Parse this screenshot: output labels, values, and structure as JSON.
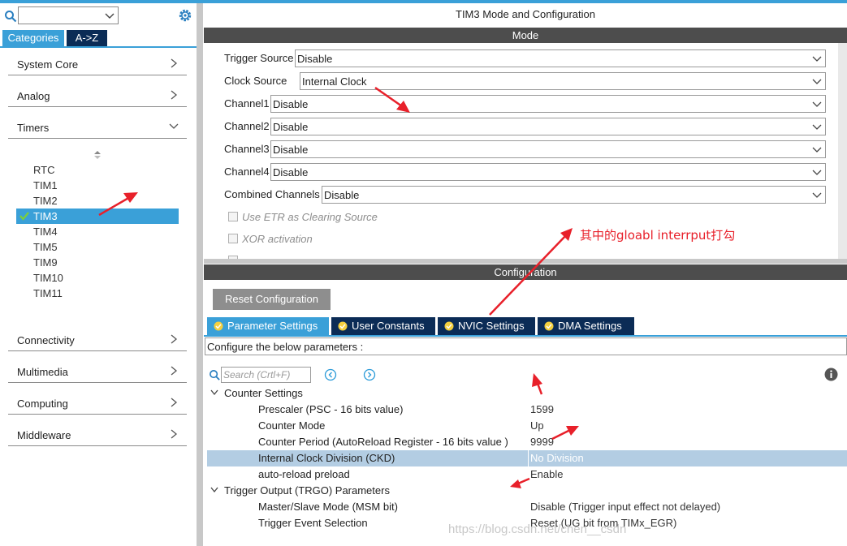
{
  "colors": {
    "accent": "#3aa0d8",
    "navy": "#0b2c56",
    "band": "#4d4d4d",
    "selected_row": "#b3cde3",
    "annotation": "#e8202a"
  },
  "left": {
    "tabs": {
      "categories": "Categories",
      "az": "A->Z"
    },
    "categories": [
      "System Core",
      "Analog",
      "Timers"
    ],
    "timers": [
      "RTC",
      "TIM1",
      "TIM2",
      "TIM3",
      "TIM4",
      "TIM5",
      "TIM9",
      "TIM10",
      "TIM11"
    ],
    "selected_timer": "TIM3",
    "bottom_categories": [
      "Connectivity",
      "Multimedia",
      "Computing",
      "Middleware"
    ]
  },
  "right": {
    "title": "TIM3 Mode and Configuration",
    "mode_band": "Mode",
    "mode_rows": [
      {
        "label": "Trigger Source",
        "value": "Disable"
      },
      {
        "label": "Clock Source",
        "value": "Internal Clock"
      },
      {
        "label": "Channel1",
        "value": "Disable"
      },
      {
        "label": "Channel2",
        "value": "Disable"
      },
      {
        "label": "Channel3",
        "value": "Disable"
      },
      {
        "label": "Channel4",
        "value": "Disable"
      },
      {
        "label": "Combined Channels",
        "value": "Disable"
      }
    ],
    "checkboxes": [
      "Use ETR as Clearing Source",
      "XOR activation"
    ],
    "config_band": "Configuration",
    "reset_button": "Reset Configuration",
    "config_tabs": [
      "Parameter Settings",
      "User Constants",
      "NVIC Settings",
      "DMA Settings"
    ],
    "configure_text": "Configure the below parameters :",
    "search_placeholder": "Search (Crtl+F)",
    "groups": {
      "counter": "Counter Settings",
      "trgo": "Trigger Output (TRGO) Parameters"
    },
    "params": [
      {
        "name": "Prescaler (PSC - 16 bits value)",
        "value": "1599"
      },
      {
        "name": "Counter Mode",
        "value": "Up"
      },
      {
        "name": "Counter Period (AutoReload Register - 16 bits value )",
        "value": "9999"
      },
      {
        "name": "Internal Clock Division (CKD)",
        "value": "No Division"
      },
      {
        "name": "auto-reload preload",
        "value": "Enable"
      },
      {
        "name": "Master/Slave Mode (MSM bit)",
        "value": "Disable (Trigger input effect not delayed)"
      },
      {
        "name": "Trigger Event Selection",
        "value": "Reset (UG bit from TIMx_EGR)"
      }
    ]
  },
  "annotation_text": "其中的gloabl interrput打勾",
  "watermark": "https://blog.csdn.net/chen__csdn"
}
